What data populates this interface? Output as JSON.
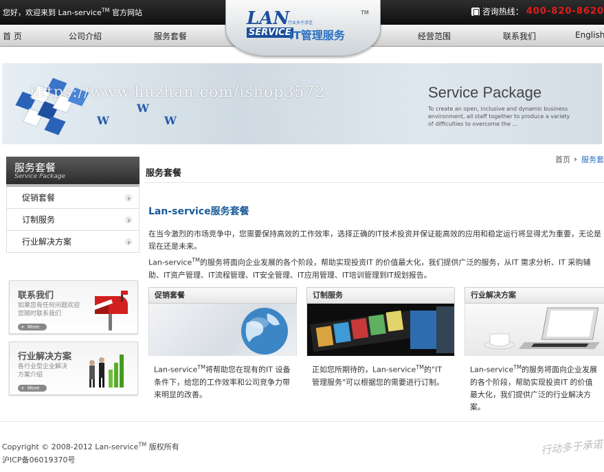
{
  "header": {
    "greeting_pre": "您好，欢迎来到 Lan-service",
    "greeting_tm": "TM",
    "greeting_post": " 官方网站",
    "hotline_label": "咨询热线：",
    "hotline_number": "400-820-8620",
    "logo_lan": "LAN",
    "logo_service": "SERVICE",
    "logo_it": "IT管理服务",
    "logo_tagline": "行业多于求佳",
    "logo_tm": "TM"
  },
  "nav": {
    "home": "首 页",
    "about": "公司介绍",
    "packages": "服务套餐",
    "scope": "经营范围",
    "contact": "联系我们",
    "english": "English"
  },
  "banner": {
    "title": "Service Package",
    "description": "To create an open, inclusive and dynamic business environment, all staff together to produce a variety of difficulties to overcome the ...",
    "watermark": "https://www.huzhan.com/ishop3572"
  },
  "sidebar": {
    "title": "服务套餐",
    "subtitle": "Service Package",
    "items": [
      {
        "label": "促销套餐"
      },
      {
        "label": "订制服务"
      },
      {
        "label": "行业解决方案"
      }
    ],
    "contact_box": {
      "title": "联系我们",
      "desc": "如果您有任何问题欢迎您随时联系我们",
      "more": "More"
    },
    "solution_box": {
      "title": "行业解决方案",
      "desc": "各行业型企业解决方案介绍",
      "more": "More"
    }
  },
  "breadcrumb": {
    "home": "首页",
    "current": "服务套"
  },
  "main": {
    "section_title": "服务套餐",
    "heading": "Lan-service服务套餐",
    "para1": "在当今激烈的市场竞争中，您需要保持高效的工作效率，选择正确的IT技术投资并保证能高效的应用和稳定运行将显得尤为重要，无论是现在还是未来。",
    "para2_pre": "Lan-service",
    "para2_tm": "TM",
    "para2_post": "的服务将面向企业发展的各个阶段，帮助实现投资IT 的价值最大化，我们提供广泛的服务，从IT 需求分析、IT 采购辅助、IT资产管理、IT流程管理、IT安全管理、IT应用管理、IT培训管理到IT规划报告。",
    "cards": [
      {
        "title": "促销套餐",
        "text_pre": "Lan-service",
        "text_tm": "TM",
        "text_post": "将帮助您在现有的IT 设备条件下，给您的工作效率和公司竞争力带来明显的改善。"
      },
      {
        "title": "订制服务",
        "text_pre": "正如您所期待的，Lan-service",
        "text_tm": "TM",
        "text_post": "的\"IT 管理服务\"可以根据您的需要进行订制。"
      },
      {
        "title": "行业解决方案",
        "text_pre": "Lan-service",
        "text_tm": "TM",
        "text_post": "的服务将面向企业发展的各个阶段，帮助实现投资IT 的价值最大化，我们提供广泛的行业解决方案。"
      }
    ]
  },
  "footer": {
    "copyright_pre": "Copyright © 2008-2012 Lan-service",
    "copyright_tm": "TM",
    "copyright_post": " 版权所有",
    "icp": "沪ICP备06019370号",
    "signature": "行动多于承诺"
  },
  "colors": {
    "accent_blue": "#1a5a9a",
    "hotline_red": "#e41b1b",
    "nav_dark": "#1f1f1f"
  }
}
